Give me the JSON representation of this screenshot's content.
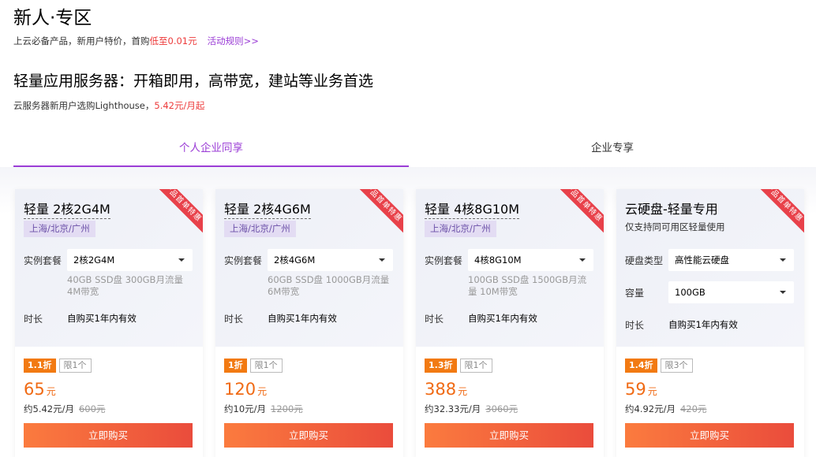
{
  "header": {
    "title": "新人·专区",
    "subtitle_prefix": "上云必备产品，新用户特价，首购",
    "subtitle_highlight": "低至0.01元",
    "rule_link": "活动规则>>"
  },
  "section": {
    "title": "轻量应用服务器：开箱即用，高带宽，建站等业务首选",
    "sub_prefix": "云服务器新用户选购Lighthouse，",
    "sub_highlight": "5.42元/月起"
  },
  "tabs": [
    {
      "label": "个人企业同享",
      "active": true
    },
    {
      "label": "企业专享",
      "active": false
    }
  ],
  "ribbon_text": "产品首单特惠",
  "cards": [
    {
      "title": "轻量 2核2G4M",
      "region": "上海/北京/广州",
      "package_label": "实例套餐",
      "package_value": "2核2G4M",
      "spec": "40GB SSD盘 300GB月流量 4M带宽",
      "duration_label": "时长",
      "duration_value": "自购买1年内有效",
      "discount": "1.1折",
      "limit": "限1个",
      "price": "65",
      "price_unit": "元",
      "monthly": "约5.42元/月",
      "original": "600元",
      "buy": "立即购买"
    },
    {
      "title": "轻量 2核4G6M",
      "region": "上海/北京/广州",
      "package_label": "实例套餐",
      "package_value": "2核4G6M",
      "spec": "60GB SSD盘 1000GB月流量 6M带宽",
      "duration_label": "时长",
      "duration_value": "自购买1年内有效",
      "discount": "1折",
      "limit": "限1个",
      "price": "120",
      "price_unit": "元",
      "monthly": "约10元/月",
      "original": "1200元",
      "buy": "立即购买"
    },
    {
      "title": "轻量 4核8G10M",
      "region": "上海/北京/广州",
      "package_label": "实例套餐",
      "package_value": "4核8G10M",
      "spec": "100GB SSD盘 1500GB月流量 10M带宽",
      "duration_label": "时长",
      "duration_value": "自购买1年内有效",
      "discount": "1.3折",
      "limit": "限1个",
      "price": "388",
      "price_unit": "元",
      "monthly": "约32.33元/月",
      "original": "3060元",
      "buy": "立即购买"
    },
    {
      "title": "云硬盘-轻量专用",
      "desc": "仅支持同可用区轻量使用",
      "type_label": "硬盘类型",
      "type_value": "高性能云硬盘",
      "capacity_label": "容量",
      "capacity_value": "100GB",
      "duration_label": "时长",
      "duration_value": "自购买1年内有效",
      "discount": "1.4折",
      "limit": "限3个",
      "price": "59",
      "price_unit": "元",
      "monthly": "约4.92元/月",
      "original": "420元",
      "buy": "立即购买"
    }
  ],
  "colors": {
    "accent_purple": "#9b3dd6",
    "price_orange": "#f06a14",
    "highlight_red": "#ed3b3b",
    "ribbon_red": "#e8414a"
  }
}
